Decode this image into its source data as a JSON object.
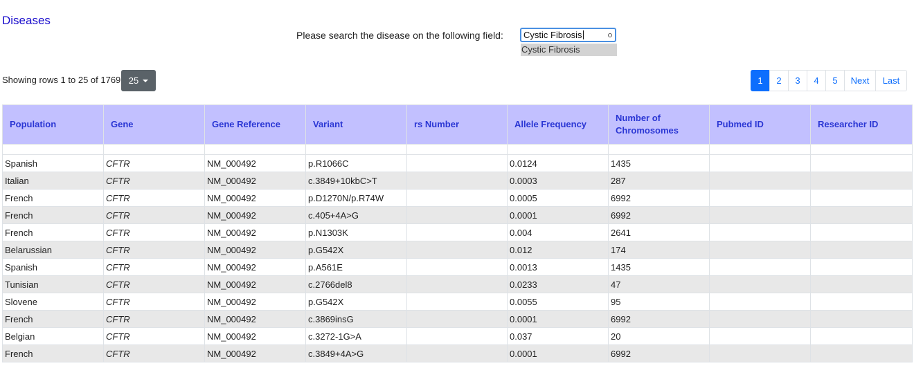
{
  "page": {
    "title": "Diseases"
  },
  "search": {
    "label": "Please search the disease on the following field:",
    "value": "Cystic Fibrosis",
    "suggestion": "Cystic Fibrosis"
  },
  "toolbar": {
    "rows_info": "Showing rows 1 to 25 of 1769",
    "page_size": "25"
  },
  "pagination": {
    "pages": [
      "1",
      "2",
      "3",
      "4",
      "5"
    ],
    "active": "1",
    "next": "Next",
    "last": "Last"
  },
  "table": {
    "headers": [
      "Population",
      "Gene",
      "Gene Reference",
      "Variant",
      "rs Number",
      "Allele Frequency",
      "Number of Chromosomes",
      "Pubmed ID",
      "Researcher ID"
    ],
    "rows": [
      [
        "Spanish",
        "CFTR",
        "NM_000492",
        "p.R1066C",
        "",
        "0.0124",
        "1435",
        "",
        ""
      ],
      [
        "Italian",
        "CFTR",
        "NM_000492",
        "c.3849+10kbC>T",
        "",
        "0.0003",
        "287",
        "",
        ""
      ],
      [
        "French",
        "CFTR",
        "NM_000492",
        "p.D1270N/p.R74W",
        "",
        "0.0005",
        "6992",
        "",
        ""
      ],
      [
        "French",
        "CFTR",
        "NM_000492",
        "c.405+4A>G",
        "",
        "0.0001",
        "6992",
        "",
        ""
      ],
      [
        "French",
        "CFTR",
        "NM_000492",
        "p.N1303K",
        "",
        "0.004",
        "2641",
        "",
        ""
      ],
      [
        "Belarussian",
        "CFTR",
        "NM_000492",
        "p.G542X",
        "",
        "0.012",
        "174",
        "",
        ""
      ],
      [
        "Spanish",
        "CFTR",
        "NM_000492",
        "p.A561E",
        "",
        "0.0013",
        "1435",
        "",
        ""
      ],
      [
        "Tunisian",
        "CFTR",
        "NM_000492",
        "c.2766del8",
        "",
        "0.0233",
        "47",
        "",
        ""
      ],
      [
        "Slovene",
        "CFTR",
        "NM_000492",
        "p.G542X",
        "",
        "0.0055",
        "95",
        "",
        ""
      ],
      [
        "French",
        "CFTR",
        "NM_000492",
        "c.3869insG",
        "",
        "0.0001",
        "6992",
        "",
        ""
      ],
      [
        "Belgian",
        "CFTR",
        "NM_000492",
        "c.3272-1G>A",
        "",
        "0.037",
        "20",
        "",
        ""
      ],
      [
        "French",
        "CFTR",
        "NM_000492",
        "c.3849+4A>G",
        "",
        "0.0001",
        "6992",
        "",
        ""
      ]
    ]
  }
}
